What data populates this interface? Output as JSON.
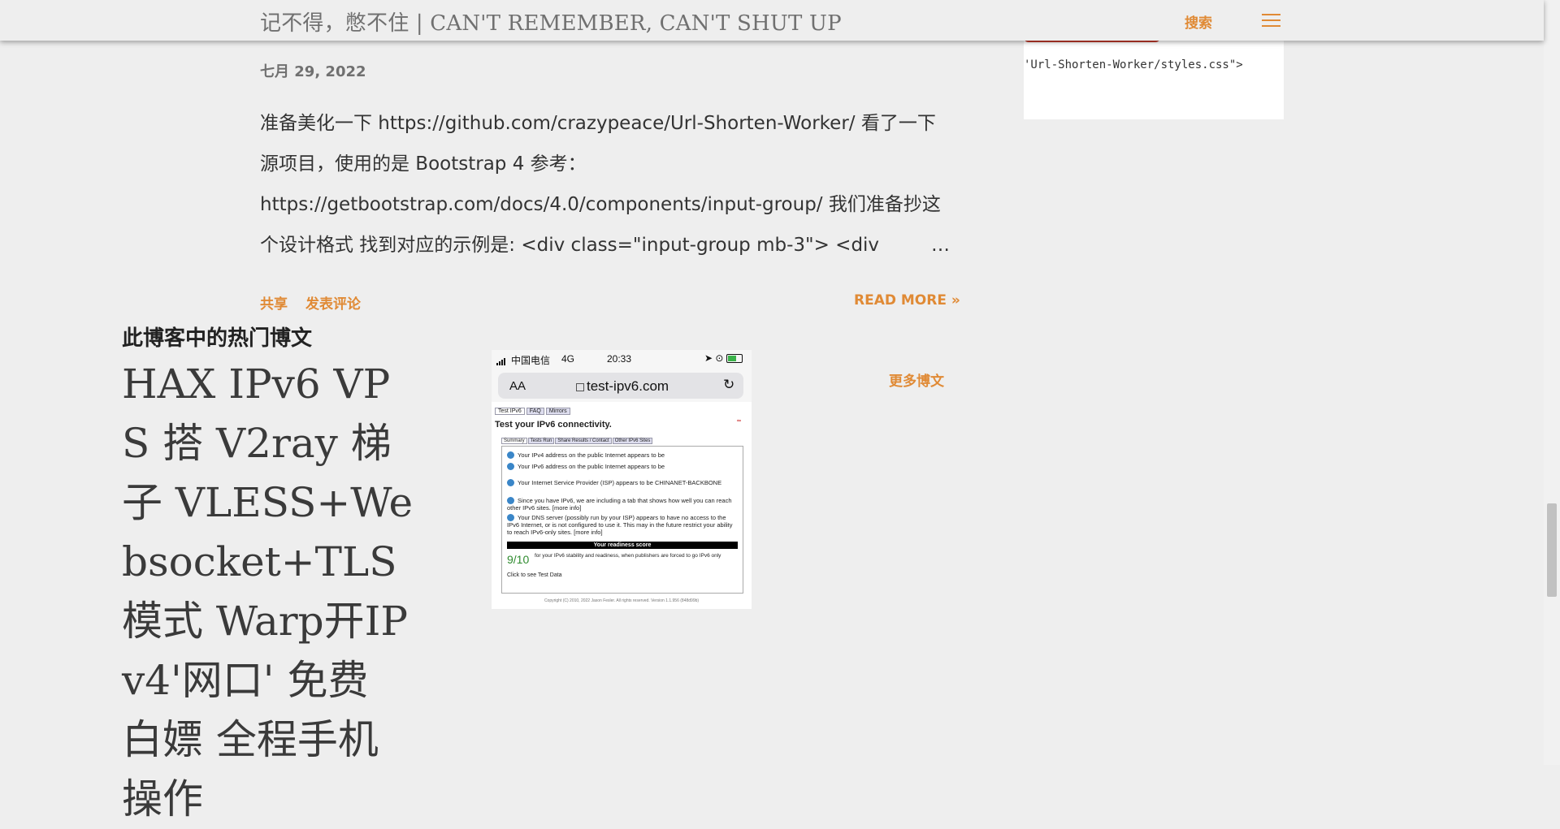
{
  "header": {
    "blog_title": "记不得，憋不住 | CAN'T REMEMBER, CAN'T SHUT UP",
    "search_label": "搜索",
    "menu_icon": "hamburger-menu-icon"
  },
  "sidebar": {
    "code_snippet": "'Url-Shorten-Worker/styles.css\">"
  },
  "post": {
    "date": "七月 29, 2022",
    "snippet_lines": [
      "准备美化一下 https://github.com/crazypeace/Url-Shorten-Worker/ 看了一下",
      "源项目，使用的是 Bootstrap 4 参考：",
      "https://getbootstrap.com/docs/4.0/components/input-group/ 我们准备抄这",
      "个设计格式 找到对应的示例是: <div class=\"input-group mb-3\">   <div"
    ],
    "ellipsis": "…",
    "share_label": "共享",
    "comment_label": "发表评论",
    "read_more_label": "READ MORE »"
  },
  "popular": {
    "heading": "此博客中的热门博文",
    "title": "HAX IPv6 VPS 搭 V2ray 梯子 VLESS+Websocket+TLS 模式 Warp开IPv4'网口' 免费 白嫖 全程手机操作",
    "more_posts_label": "更多博文",
    "thumbnail": {
      "carrier": "中国电信",
      "network": "4G",
      "time": "20:33",
      "aa": "AA",
      "url": "test-ipv6.com",
      "tabs": [
        "Test IPv6",
        "FAQ",
        "Mirrors"
      ],
      "heading": "Test your IPv6 connectivity.",
      "subtabs": [
        "Summary",
        "Tests Run",
        "Share Results / Contact",
        "Other IPv6 Sites"
      ],
      "rows": [
        "Your IPv4 address on the public Internet appears to be",
        "Your IPv6 address on the public Internet appears to be",
        "Your Internet Service Provider (ISP) appears to be CHINANET-BACKBONE",
        "Since you have IPv6, we are including a tab that shows how well you can reach other IPv6 sites. [more info]",
        "Your DNS server (possibly run by your ISP) appears to have no access to the IPv6 Internet, or is not configured to use it. This may in the future restrict your ability to reach IPv6-only sites. [more info]"
      ],
      "score_heading": "Your readiness score",
      "score": "9/10",
      "score_text": "for your IPv6 stability and readiness, when publishers are forced to go IPv6 only",
      "test_data": "Click to see Test Data",
      "footer": "Copyright (C) 2010, 2022 Jason Fesler. All rights reserved. Version 1.1.956 (848d99b)"
    }
  }
}
